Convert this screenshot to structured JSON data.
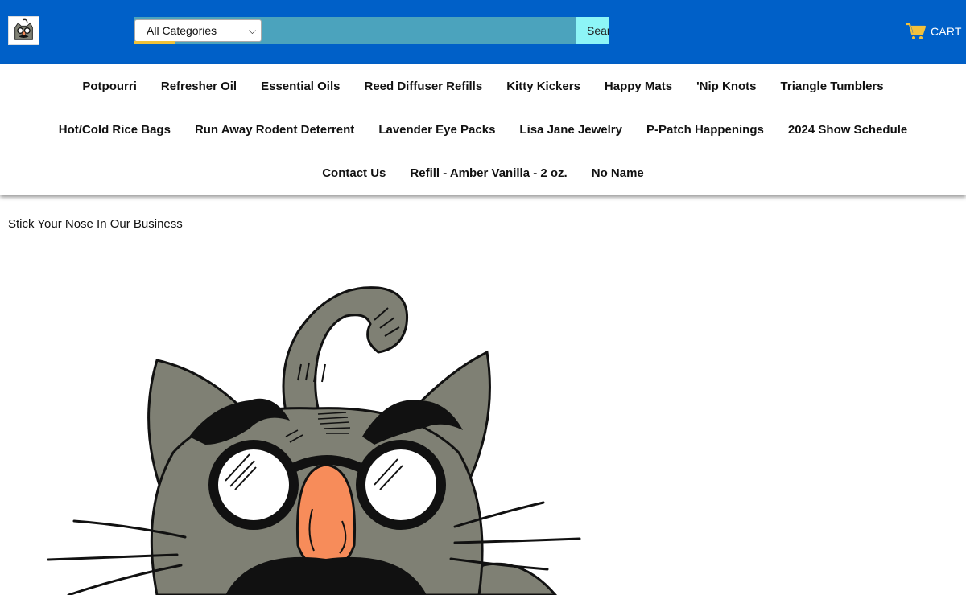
{
  "header": {
    "logo_alt": "cat logo",
    "search": {
      "category_selected": "All Categories",
      "button_label": "Search",
      "placeholder": ""
    },
    "cart_label": "CART"
  },
  "nav": {
    "row1": [
      "Potpourri",
      "Refresher Oil",
      "Essential Oils",
      "Reed Diffuser Refills",
      "Kitty Kickers",
      "Happy Mats",
      "'Nip Knots",
      "Triangle Tumblers"
    ],
    "row2": [
      "Hot/Cold Rice Bags",
      "Run Away Rodent Deterrent",
      "Lavender Eye Packs",
      "Lisa Jane Jewelry",
      "P-Patch Happenings",
      "2024 Show Schedule"
    ],
    "row3": [
      "Contact Us",
      "Refill - Amber Vanilla - 2 oz.",
      "No Name"
    ]
  },
  "main": {
    "tagline": "Stick Your Nose In Our Business",
    "hero_icon": "cat-in-disguise-illustration"
  },
  "colors": {
    "topbar": "#0060c8",
    "search_bg": "#4ba3bd",
    "search_button": "#8df5f7",
    "cart_icon": "#f3c13c",
    "cat_fur": "#7f8074",
    "cat_nose": "#f78c5a"
  }
}
